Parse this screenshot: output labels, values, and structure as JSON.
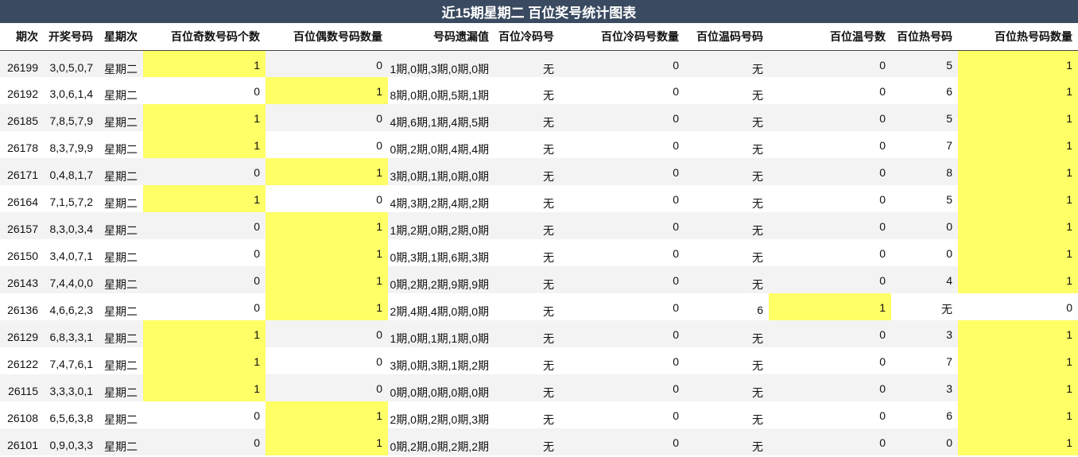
{
  "title": "近15期星期二 百位奖号统计图表",
  "columns": [
    "期次",
    "开奖号码",
    "星期次",
    "百位奇数号码个数",
    "百位偶数号码数量",
    "号码遗漏值",
    "百位冷码号",
    "百位冷码号数量",
    "百位温码号码",
    "百位温号数",
    "百位热号码",
    "百位热号码数量"
  ],
  "highlight_color": "#ffff66",
  "rows": [
    [
      "26199",
      "3,0,5,0,7",
      "星期二",
      "1",
      "0",
      "1期,0期,3期,0期,0期",
      "无",
      "0",
      "无",
      "0",
      "5",
      "1"
    ],
    [
      "26192",
      "3,0,6,1,4",
      "星期二",
      "0",
      "1",
      "8期,0期,0期,5期,1期",
      "无",
      "0",
      "无",
      "0",
      "6",
      "1"
    ],
    [
      "26185",
      "7,8,5,7,9",
      "星期二",
      "1",
      "0",
      "4期,6期,1期,4期,5期",
      "无",
      "0",
      "无",
      "0",
      "5",
      "1"
    ],
    [
      "26178",
      "8,3,7,9,9",
      "星期二",
      "1",
      "0",
      "0期,2期,0期,4期,4期",
      "无",
      "0",
      "无",
      "0",
      "7",
      "1"
    ],
    [
      "26171",
      "0,4,8,1,7",
      "星期二",
      "0",
      "1",
      "3期,0期,1期,0期,0期",
      "无",
      "0",
      "无",
      "0",
      "8",
      "1"
    ],
    [
      "26164",
      "7,1,5,7,2",
      "星期二",
      "1",
      "0",
      "4期,3期,2期,4期,2期",
      "无",
      "0",
      "无",
      "0",
      "5",
      "1"
    ],
    [
      "26157",
      "8,3,0,3,4",
      "星期二",
      "0",
      "1",
      "1期,2期,0期,2期,0期",
      "无",
      "0",
      "无",
      "0",
      "0",
      "1"
    ],
    [
      "26150",
      "3,4,0,7,1",
      "星期二",
      "0",
      "1",
      "0期,3期,1期,6期,3期",
      "无",
      "0",
      "无",
      "0",
      "0",
      "1"
    ],
    [
      "26143",
      "7,4,4,0,0",
      "星期二",
      "0",
      "1",
      "0期,2期,2期,9期,9期",
      "无",
      "0",
      "无",
      "0",
      "4",
      "1"
    ],
    [
      "26136",
      "4,6,6,2,3",
      "星期二",
      "0",
      "1",
      "2期,4期,4期,0期,0期",
      "无",
      "0",
      "6",
      "1",
      "无",
      "0"
    ],
    [
      "26129",
      "6,8,3,3,1",
      "星期二",
      "1",
      "0",
      "1期,0期,1期,1期,0期",
      "无",
      "0",
      "无",
      "0",
      "3",
      "1"
    ],
    [
      "26122",
      "7,4,7,6,1",
      "星期二",
      "1",
      "0",
      "3期,0期,3期,1期,2期",
      "无",
      "0",
      "无",
      "0",
      "7",
      "1"
    ],
    [
      "26115",
      "3,3,3,0,1",
      "星期二",
      "1",
      "0",
      "0期,0期,0期,0期,0期",
      "无",
      "0",
      "无",
      "0",
      "3",
      "1"
    ],
    [
      "26108",
      "6,5,6,3,8",
      "星期二",
      "0",
      "1",
      "2期,0期,2期,0期,3期",
      "无",
      "0",
      "无",
      "0",
      "6",
      "1"
    ],
    [
      "26101",
      "0,9,0,3,3",
      "星期二",
      "0",
      "1",
      "0期,2期,0期,2期,2期",
      "无",
      "0",
      "无",
      "0",
      "0",
      "1"
    ]
  ]
}
